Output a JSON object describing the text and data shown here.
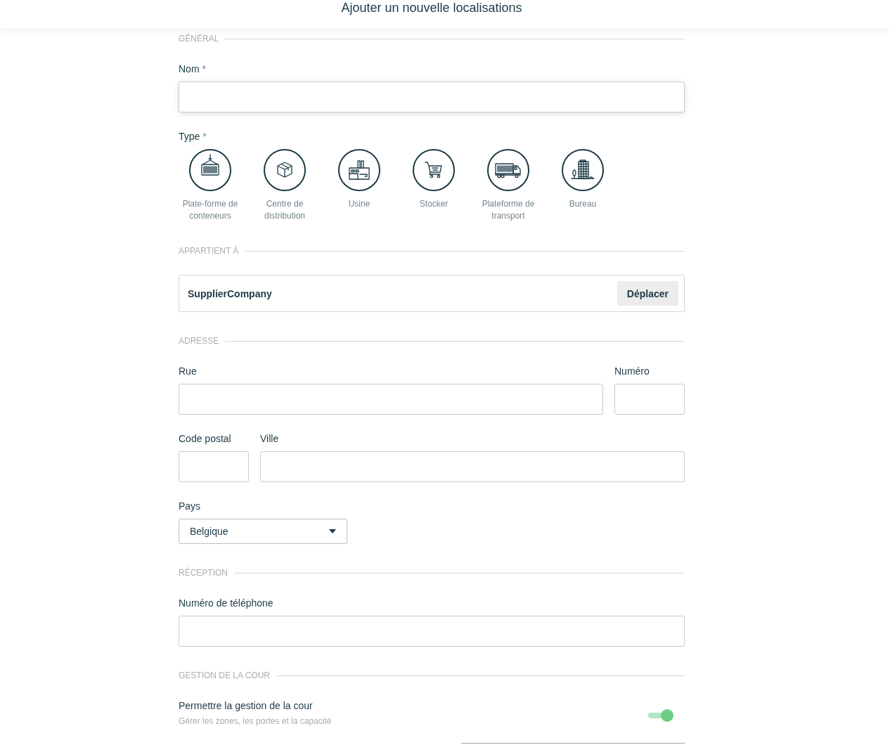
{
  "header": {
    "title": "Ajouter un nouvelle localisations"
  },
  "sections": [
    {
      "title": "GÉNÉRAL",
      "items": [
        {
          "kind": "fields",
          "fields": [
            {
              "label": "Nom",
              "required_mark": "*",
              "kind": "wide",
              "focused": true
            }
          ]
        },
        {
          "kind": "types",
          "label": "Type",
          "required_mark": "*",
          "options": [
            {
              "label": "Plate-forme de conteneurs",
              "kind": "container",
              "selected": false
            },
            {
              "label": "Centre de distribution",
              "kind": "box",
              "selected": false
            },
            {
              "label": "Usine",
              "kind": "factory",
              "selected": false
            },
            {
              "label": "Stocker",
              "kind": "cart",
              "selected": false
            },
            {
              "label": "Plateforme de transport",
              "kind": "truck",
              "selected": false
            },
            {
              "label": "Bureau",
              "kind": "building",
              "selected": false
            }
          ]
        }
      ]
    },
    {
      "title": "APPARTIENT À",
      "items": [
        {
          "kind": "owner",
          "name": "SupplierCompany",
          "button": "Déplacer"
        }
      ]
    },
    {
      "title": "ADRESSE",
      "items": [
        {
          "kind": "fields",
          "fields": [
            {
              "label": "Rue",
              "kind": "wide",
              "focused": false
            },
            {
              "label": "Numéro",
              "kind": "short",
              "focused": false
            }
          ]
        },
        {
          "kind": "fields",
          "fields": [
            {
              "label": "Code postal",
              "kind": "short",
              "focused": false
            },
            {
              "label": "Ville",
              "kind": "wide",
              "focused": false
            }
          ]
        },
        {
          "kind": "select",
          "label": "Pays",
          "value": "Belgique"
        }
      ]
    },
    {
      "title": "RÉCEPTION",
      "items": [
        {
          "kind": "fields",
          "fields": [
            {
              "label": "Numéro de téléphone",
              "kind": "wide",
              "focused": false
            }
          ]
        }
      ]
    },
    {
      "title": "GESTION DE LA COUR",
      "items": [
        {
          "kind": "toggle",
          "label": "Permettre la gestion de la cour",
          "description": "Gérer les zones, les portes et la capacité",
          "on": true
        }
      ]
    }
  ]
}
